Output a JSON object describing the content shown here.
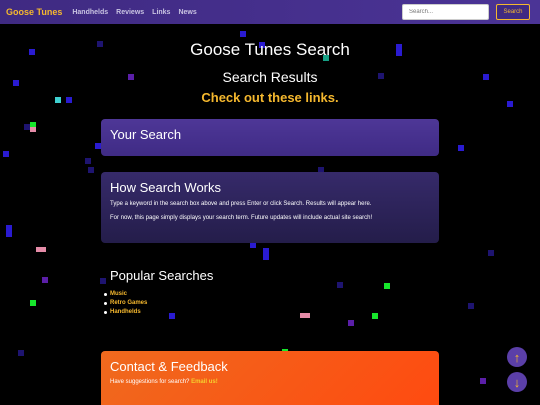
{
  "navbar": {
    "brand": "Goose Tunes",
    "links": [
      "Handhelds",
      "Reviews",
      "Links",
      "News"
    ],
    "search_placeholder": "Search...",
    "search_button": "Search"
  },
  "header": {
    "title": "Goose Tunes Search",
    "subtitle": "Search Results",
    "tagline": "Check out these links."
  },
  "your_search": {
    "heading": "Your Search"
  },
  "how_it_works": {
    "heading": "How Search Works",
    "paragraphs": [
      "Type a keyword in the search box above and press Enter or click Search. Results will appear here.",
      "For now, this page simply displays your search term. Future updates will include actual site search!"
    ]
  },
  "popular": {
    "heading": "Popular Searches",
    "items": [
      "Music",
      "Retro Games",
      "Handhelds"
    ]
  },
  "contact": {
    "heading": "Contact & Feedback",
    "text": "Have suggestions for search?",
    "link": "Email us!"
  },
  "scroll": {
    "up_icon": "↑",
    "down_icon": "↓"
  },
  "colors": {
    "accent": "#f5b82e",
    "navbar": "#3f2a82",
    "contact": "#ef6a1e"
  }
}
